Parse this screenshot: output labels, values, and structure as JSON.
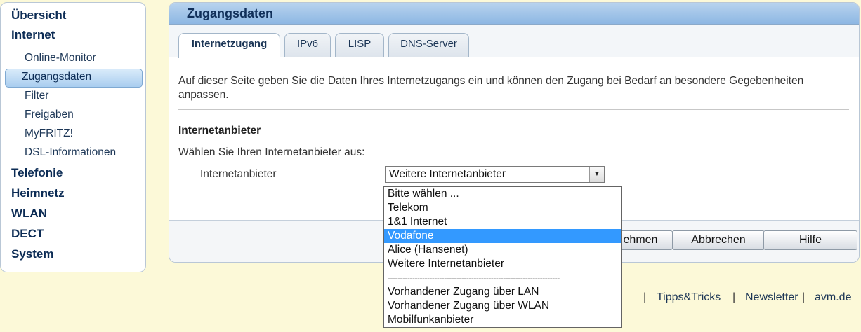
{
  "sidebar": {
    "items_top": [
      "Übersicht",
      "Internet"
    ],
    "internet_sub": [
      "Online-Monitor",
      "Zugangsdaten",
      "Filter",
      "Freigaben",
      "MyFRITZ!",
      "DSL-Informationen"
    ],
    "items_bottom": [
      "Telefonie",
      "Heimnetz",
      "WLAN",
      "DECT",
      "System"
    ]
  },
  "main": {
    "title": "Zugangsdaten",
    "tabs": [
      "Internetzugang",
      "IPv6",
      "LISP",
      "DNS-Server"
    ],
    "intro": "Auf dieser Seite geben Sie die Daten Ihres Internetzugangs ein und können den Zugang bei Bedarf an besondere Gegebenheiten anpassen.",
    "section_title": "Internetanbieter",
    "choose_text": "Wählen Sie Ihren Internetanbieter aus:",
    "provider_label": "Internetanbieter",
    "provider_value": "Weitere Internetanbieter",
    "buttons": {
      "apply_partial": "ehmen",
      "cancel": "Abbrechen",
      "help": "Hilfe"
    }
  },
  "dropdown": {
    "options": [
      "Bitte wählen ...",
      "Telekom",
      "1&1 Internet",
      "Vodafone",
      "Alice (Hansenet)",
      "Weitere Internetanbieter",
      "----------------------------------------------------------------------",
      "Vorhandener Zugang über LAN",
      "Vorhandener Zugang über WLAN",
      "Mobilfunkanbieter"
    ],
    "selected": "Vodafone"
  },
  "footer": {
    "partial": "ch",
    "tips": "Tipps&Tricks",
    "newsletter": "Newsletter",
    "site": "avm.de",
    "separator": "|"
  },
  "colors": {
    "accent": "#3399ff",
    "header": "#8db7e3",
    "background": "#fcf9d8"
  }
}
